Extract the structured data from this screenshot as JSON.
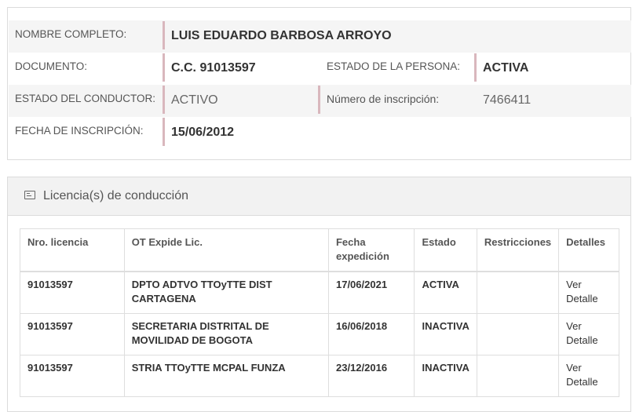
{
  "persona": {
    "nombre_label": "NOMBRE COMPLETO:",
    "nombre_value": "LUIS EDUARDO BARBOSA ARROYO",
    "documento_label": "DOCUMENTO:",
    "documento_value": "C.C. 91013597",
    "estado_persona_label": "ESTADO DE LA PERSONA:",
    "estado_persona_value": "ACTIVA",
    "estado_conductor_label": "ESTADO DEL CONDUCTOR:",
    "estado_conductor_value": "ACTIVO",
    "numero_inscripcion_label": "Número de inscripción:",
    "numero_inscripcion_value": "7466411",
    "fecha_inscripcion_label": "FECHA DE INSCRIPCIÓN:",
    "fecha_inscripcion_value": "15/06/2012"
  },
  "licencias": {
    "title": "Licencia(s) de conducción",
    "icon": "id-card-icon",
    "headers": {
      "nro": "Nro. licencia",
      "ot": "OT Expide Lic.",
      "fecha": "Fecha expedición",
      "estado": "Estado",
      "restricciones": "Restricciones",
      "detalles": "Detalles"
    },
    "rows": [
      {
        "nro": "91013597",
        "ot": "DPTO ADTVO TTOyTTE DIST CARTAGENA",
        "fecha": "17/06/2021",
        "estado": "ACTIVA",
        "restricciones": "",
        "detalle": "Ver Detalle"
      },
      {
        "nro": "91013597",
        "ot": "SECRETARIA DISTRITAL DE MOVILIDAD DE BOGOTA",
        "fecha": "16/06/2018",
        "estado": "INACTIVA",
        "restricciones": "",
        "detalle": "Ver Detalle"
      },
      {
        "nro": "91013597",
        "ot": "STRIA TTOyTTE MCPAL FUNZA",
        "fecha": "23/12/2016",
        "estado": "INACTIVA",
        "restricciones": "",
        "detalle": "Ver Detalle"
      }
    ]
  }
}
